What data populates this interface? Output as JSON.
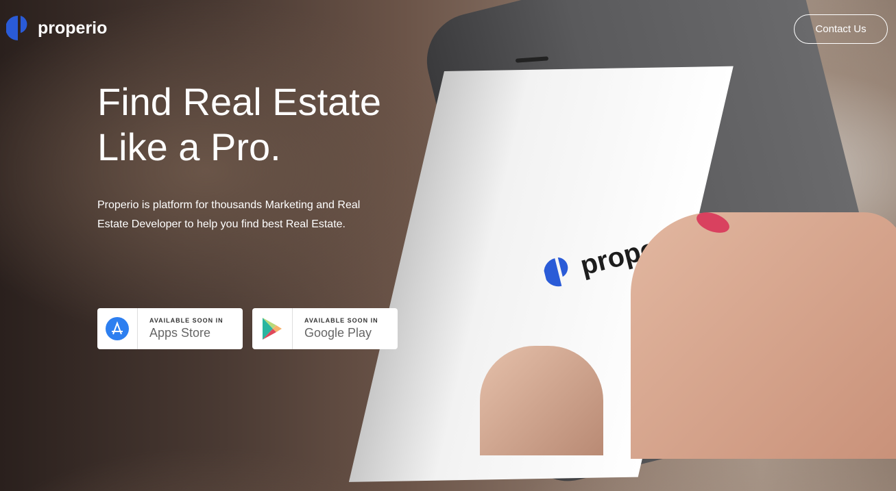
{
  "brand": {
    "name": "properio",
    "color": "#2a5bd7"
  },
  "nav": {
    "contact_label": "Contact Us"
  },
  "hero": {
    "title_line1": "Find Real Estate",
    "title_line2": "Like a Pro.",
    "description": "Properio is platform for thousands Marketing and Real Estate Developer to help you find best Real Estate."
  },
  "stores": [
    {
      "small": "AVAILABLE SOON IN",
      "name": "Apps Store",
      "icon": "app-store-icon"
    },
    {
      "small": "AVAILABLE SOON IN",
      "name": "Google Play",
      "icon": "google-play-icon"
    }
  ],
  "phone": {
    "screen_logo": "properio"
  }
}
